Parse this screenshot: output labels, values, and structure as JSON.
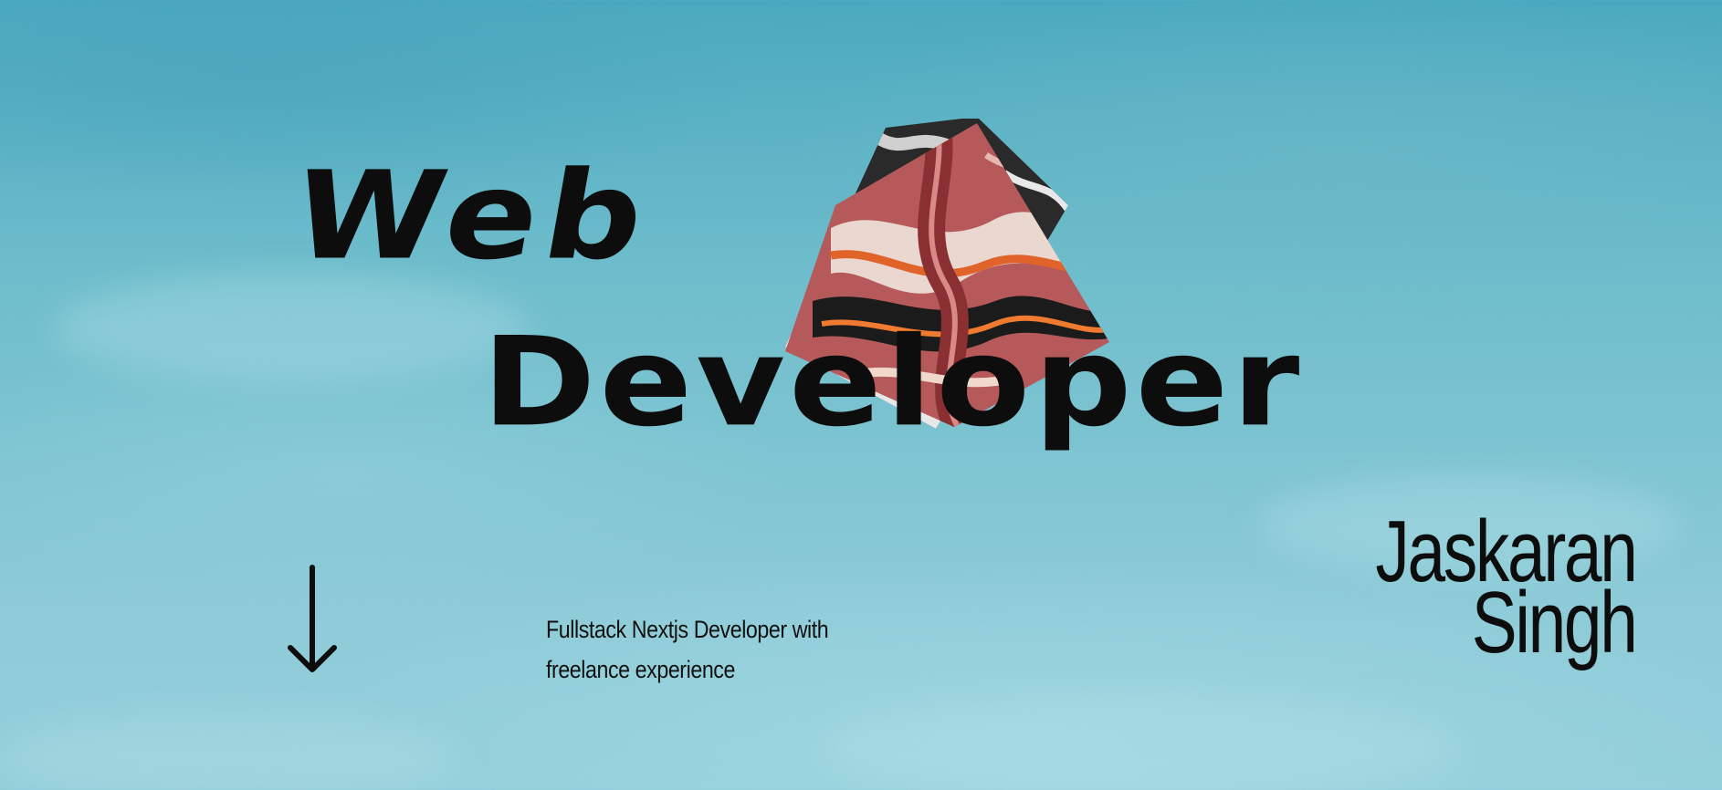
{
  "hero": {
    "title_line1": "Web",
    "title_line2": "Developer",
    "tagline": "Fullstack Nextjs Developer with freelance experience",
    "name_first": "Jaskaran",
    "name_last": "Singh",
    "scroll_icon": "arrow-down-icon",
    "art_icon": "abstract-artwork"
  },
  "colors": {
    "background": "#6fbdcc",
    "text": "#0d0d0d",
    "art_primary": "#b5595a",
    "art_accent": "#e0642a"
  }
}
